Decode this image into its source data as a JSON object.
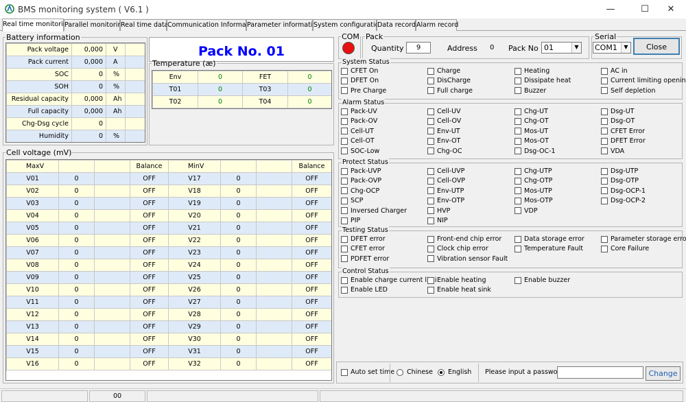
{
  "app": {
    "title": "BMS monitoring system  ( V6.1 )"
  },
  "window": {
    "minimize": "—",
    "maximize": "☐",
    "close": "✕"
  },
  "tabs": [
    "Real time monitoring",
    "Parallel monitoring",
    "Real time data",
    "Communication Information",
    "Parameter information",
    "System configuration",
    "Data record",
    "Alarm record"
  ],
  "battery": {
    "legend": "Battery information",
    "rows": [
      {
        "label": "Pack voltage",
        "value": "0,000",
        "unit": "V"
      },
      {
        "label": "Pack current",
        "value": "0,000",
        "unit": "A"
      },
      {
        "label": "SOC",
        "value": "0",
        "unit": "%"
      },
      {
        "label": "SOH",
        "value": "0",
        "unit": "%"
      },
      {
        "label": "Residual capacity",
        "value": "0,000",
        "unit": "Ah"
      },
      {
        "label": "Full capacity",
        "value": "0,000",
        "unit": "Ah"
      },
      {
        "label": "Chg-Dsg cycle",
        "value": "0",
        "unit": ""
      },
      {
        "label": "Humidity",
        "value": "0",
        "unit": "%"
      }
    ]
  },
  "pack_title": "Pack No. 01",
  "temperature": {
    "legend": "Temperature (æ)",
    "headers": [
      "Env",
      "0",
      "FET",
      "0"
    ],
    "rows": [
      [
        "T01",
        "0",
        "T03",
        "0"
      ],
      [
        "T02",
        "0",
        "T04",
        "0"
      ]
    ]
  },
  "cells": {
    "legend": "Cell voltage (mV)",
    "headers": [
      "MaxV",
      "",
      "",
      "Balance",
      "MinV",
      "",
      "",
      "Balance"
    ],
    "rows": [
      [
        "V01",
        "0",
        "OFF",
        "V17",
        "0",
        "OFF"
      ],
      [
        "V02",
        "0",
        "OFF",
        "V18",
        "0",
        "OFF"
      ],
      [
        "V03",
        "0",
        "OFF",
        "V19",
        "0",
        "OFF"
      ],
      [
        "V04",
        "0",
        "OFF",
        "V20",
        "0",
        "OFF"
      ],
      [
        "V05",
        "0",
        "OFF",
        "V21",
        "0",
        "OFF"
      ],
      [
        "V06",
        "0",
        "OFF",
        "V22",
        "0",
        "OFF"
      ],
      [
        "V07",
        "0",
        "OFF",
        "V23",
        "0",
        "OFF"
      ],
      [
        "V08",
        "0",
        "OFF",
        "V24",
        "0",
        "OFF"
      ],
      [
        "V09",
        "0",
        "OFF",
        "V25",
        "0",
        "OFF"
      ],
      [
        "V10",
        "0",
        "OFF",
        "V26",
        "0",
        "OFF"
      ],
      [
        "V11",
        "0",
        "OFF",
        "V27",
        "0",
        "OFF"
      ],
      [
        "V12",
        "0",
        "OFF",
        "V28",
        "0",
        "OFF"
      ],
      [
        "V13",
        "0",
        "OFF",
        "V29",
        "0",
        "OFF"
      ],
      [
        "V14",
        "0",
        "OFF",
        "V30",
        "0",
        "OFF"
      ],
      [
        "V15",
        "0",
        "OFF",
        "V31",
        "0",
        "OFF"
      ],
      [
        "V16",
        "0",
        "OFF",
        "V32",
        "0",
        "OFF"
      ]
    ]
  },
  "com": {
    "legend": "COM",
    "indicator_color": "#e81010"
  },
  "pack": {
    "legend": "Pack",
    "quantity_label": "Quantity",
    "quantity": "9",
    "address_label": "Address",
    "address": "0",
    "packno_label": "Pack No",
    "packno": "01"
  },
  "serial": {
    "legend": "Serial",
    "value": "COM1",
    "close": "Close"
  },
  "sections": [
    {
      "title": "System Status",
      "items": [
        "CFET On",
        "Charge",
        "Heating",
        "AC in",
        "DFET On",
        "DisCharge",
        "Dissipate heat",
        "Current limiting opening",
        "Pre Charge",
        "Full charge",
        "Buzzer",
        "Self depletion"
      ]
    },
    {
      "title": "Alarm Status",
      "items": [
        "Pack-UV",
        "Cell-UV",
        "Chg-UT",
        "Dsg-UT",
        "Pack-OV",
        "Cell-OV",
        "Chg-OT",
        "Dsg-OT",
        "Cell-UT",
        "Env-UT",
        "Mos-UT",
        "CFET Error",
        "Cell-OT",
        "Env-OT",
        "Mos-OT",
        "DFET Error",
        "SOC-Low",
        "Chg-OC",
        "Dsg-OC-1",
        "VDA"
      ]
    },
    {
      "title": "Protect Status",
      "items": [
        "Pack-UVP",
        "Cell-UVP",
        "Chg-UTP",
        "Dsg-UTP",
        "Pack-OVP",
        "Cell-OVP",
        "Chg-OTP",
        "Dsg-OTP",
        "Chg-OCP",
        "Env-UTP",
        "Mos-UTP",
        "Dsg-OCP-1",
        "SCP",
        "Env-OTP",
        "Mos-OTP",
        "Dsg-OCP-2",
        "Inversed Charger",
        "HVP",
        "VDP",
        "",
        "PIP",
        "NIP",
        "",
        ""
      ]
    },
    {
      "title": "Testing Status",
      "items": [
        "DFET error",
        "Front-end chip error",
        "Data storage error",
        "Parameter storage error",
        "CFET error",
        "Clock chip error",
        "Temperature Fault",
        "Core Failure",
        "PDFET error",
        "Vibration sensor Fault",
        "",
        ""
      ]
    },
    {
      "title": "Control Status",
      "items": [
        "Enable charge current limi",
        "Enable heating",
        "Enable buzzer",
        "",
        "Enable LED",
        "Enable heat sink",
        "",
        ""
      ]
    }
  ],
  "bottom": {
    "auto_set_time": "Auto set time",
    "chinese": "Chinese",
    "english": "English",
    "password_label": "Please input a password",
    "change": "Change"
  },
  "status": {
    "value": "00"
  }
}
